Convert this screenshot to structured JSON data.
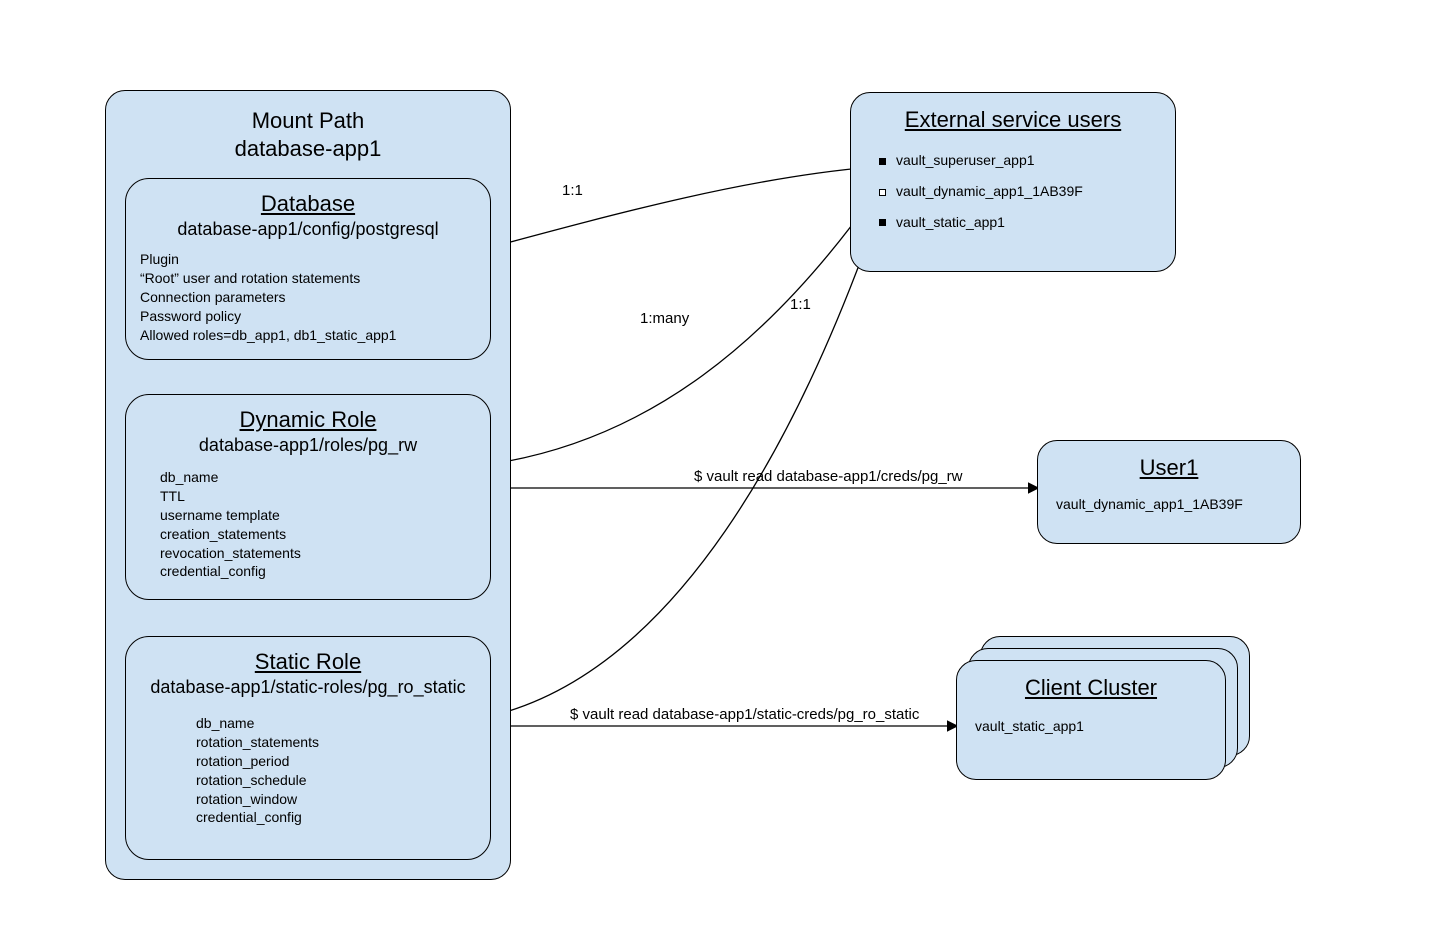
{
  "mount": {
    "title_line1": "Mount Path",
    "title_line2": "database-app1",
    "database": {
      "title": "Database",
      "path": "database-app1/config/postgresql",
      "props": [
        "Plugin",
        "“Root” user and rotation statements",
        "Connection parameters",
        "Password policy",
        "Allowed roles=db_app1, db1_static_app1"
      ]
    },
    "dynamic_role": {
      "title": "Dynamic Role",
      "path": "database-app1/roles/pg_rw",
      "props": [
        "db_name",
        "TTL",
        "username template",
        "creation_statements",
        "revocation_statements",
        "credential_config"
      ]
    },
    "static_role": {
      "title": "Static Role",
      "path": "database-app1/static-roles/pg_ro_static",
      "props": [
        "db_name",
        "rotation_statements",
        "rotation_period",
        "rotation_schedule",
        "rotation_window",
        "credential_config"
      ]
    }
  },
  "ext_users": {
    "title": "External service users",
    "items": [
      "vault_superuser_app1",
      "vault_dynamic_app1_1AB39F",
      "vault_static_app1"
    ]
  },
  "user1": {
    "title": "User1",
    "value": "vault_dynamic_app1_1AB39F"
  },
  "cluster": {
    "title": "Client Cluster",
    "value": "vault_static_app1"
  },
  "edge_labels": {
    "one_one_a": "1:1",
    "one_many": "1:many",
    "one_one_b": "1:1",
    "cmd_dynamic": "$ vault read database-app1/creds/pg_rw",
    "cmd_static": "$ vault read database-app1/static-creds/pg_ro_static"
  }
}
